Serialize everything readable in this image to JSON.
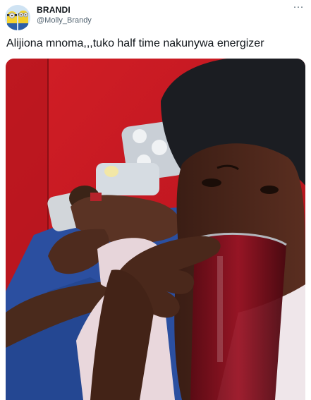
{
  "author": {
    "display_name": "BRANDI",
    "handle": "@Molly_Brandy",
    "avatar_icon": "minions-avatar-icon"
  },
  "menu": {
    "more_label": "···",
    "icon": "more-options-icon"
  },
  "tweet": {
    "text": "Alijiona mnoma,,,tuko half time nakunywa energizer"
  },
  "colors": {
    "text_primary": "#0f1419",
    "text_secondary": "#536471",
    "wall_red": "#c81a22",
    "bedsheet_blue": "#2b4fa0",
    "drink_red": "#8a0f1f"
  }
}
